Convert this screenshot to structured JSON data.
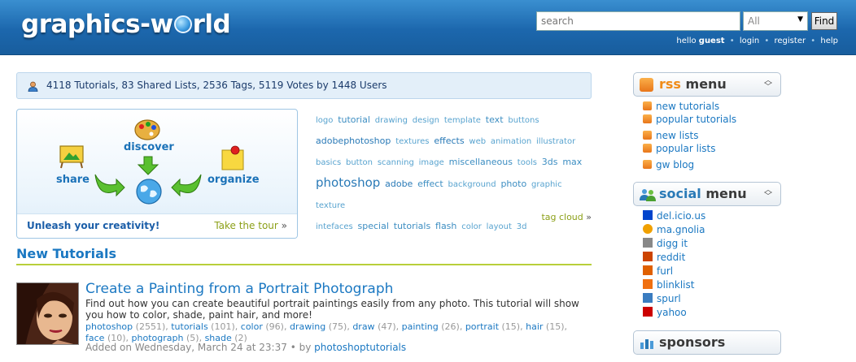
{
  "header": {
    "logo": "graphics-world",
    "search_placeholder": "search",
    "select_value": "All",
    "find_label": "Find",
    "greeting": "hello",
    "username": "guest",
    "links": [
      "login",
      "register",
      "help"
    ]
  },
  "stats": {
    "text": "4118 Tutorials, 83 Shared Lists, 2536 Tags, 5119 Votes by 1448 Users"
  },
  "tour": {
    "discover": "discover",
    "share": "share",
    "organize": "organize",
    "slogan": "Unleash your creativity!",
    "link": "Take the tour",
    "raquo": "»"
  },
  "tags": [
    {
      "t": "logo",
      "w": 0
    },
    {
      "t": "tutorial",
      "w": 1
    },
    {
      "t": "drawing",
      "w": 0
    },
    {
      "t": "design",
      "w": 0
    },
    {
      "t": "template",
      "w": 0
    },
    {
      "t": "text",
      "w": 1
    },
    {
      "t": "buttons",
      "w": 0
    },
    {
      "t": "adobephotoshop",
      "w": 2
    },
    {
      "t": "textures",
      "w": 0
    },
    {
      "t": "effects",
      "w": 2
    },
    {
      "t": "web",
      "w": 0
    },
    {
      "t": "animation",
      "w": 0
    },
    {
      "t": "illustrator",
      "w": 0
    },
    {
      "t": "basics",
      "w": 0
    },
    {
      "t": "button",
      "w": 0
    },
    {
      "t": "scanning",
      "w": 0
    },
    {
      "t": "image",
      "w": 0
    },
    {
      "t": "miscellaneous",
      "w": 1
    },
    {
      "t": "tools",
      "w": 0
    },
    {
      "t": "3ds",
      "w": 1
    },
    {
      "t": "max",
      "w": 1
    },
    {
      "t": "photoshop",
      "w": 3
    },
    {
      "t": "adobe",
      "w": 2
    },
    {
      "t": "effect",
      "w": 1
    },
    {
      "t": "background",
      "w": 0
    },
    {
      "t": "photo",
      "w": 1
    },
    {
      "t": "graphic",
      "w": 0
    },
    {
      "t": "texture",
      "w": 0
    },
    {
      "t": "intefaces",
      "w": 0
    },
    {
      "t": "special",
      "w": 1
    },
    {
      "t": "tutorials",
      "w": 1
    },
    {
      "t": "flash",
      "w": 1
    },
    {
      "t": "color",
      "w": 0
    },
    {
      "t": "layout",
      "w": 0
    },
    {
      "t": "3d",
      "w": 0
    }
  ],
  "tagcloud_link": "tag cloud",
  "section_title": "New Tutorials",
  "tutorial": {
    "title": "Create a Painting from a Portrait Photograph",
    "description": "Find out how you can create beautiful portrait paintings easily from any photo. This tutorial will show you how to color, shade, paint hair, and more!",
    "tags": [
      {
        "name": "photoshop",
        "count": "(2551)"
      },
      {
        "name": "tutorials",
        "count": "(101)"
      },
      {
        "name": "color",
        "count": "(96)"
      },
      {
        "name": "drawing",
        "count": "(75)"
      },
      {
        "name": "draw",
        "count": "(47)"
      },
      {
        "name": "painting",
        "count": "(26)"
      },
      {
        "name": "portrait",
        "count": "(15)"
      },
      {
        "name": "hair",
        "count": "(15)"
      },
      {
        "name": "face",
        "count": "(10)"
      },
      {
        "name": "photograph",
        "count": "(5)"
      },
      {
        "name": "shade",
        "count": "(2)"
      }
    ],
    "added": "Added on Wednesday, March 24 at 23:37",
    "by": "by",
    "author": "photoshoptutorials"
  },
  "rss_menu": {
    "title_hl": "rss",
    "title_rest": "menu",
    "items": [
      "new tutorials",
      "popular tutorials",
      "new lists",
      "popular lists",
      "gw blog"
    ]
  },
  "social_menu": {
    "title_hl": "social",
    "title_rest": "menu",
    "items": [
      {
        "label": "del.icio.us",
        "icon": "delicious-icon",
        "color": "#0044cc"
      },
      {
        "label": "ma.gnolia",
        "icon": "magnolia-icon",
        "color": "#f0a000"
      },
      {
        "label": "digg it",
        "icon": "digg-icon",
        "color": "#888888"
      },
      {
        "label": "reddit",
        "icon": "reddit-icon",
        "color": "#cc4400"
      },
      {
        "label": "furl",
        "icon": "furl-icon",
        "color": "#e06000"
      },
      {
        "label": "blinklist",
        "icon": "blinklist-icon",
        "color": "#f07010"
      },
      {
        "label": "spurl",
        "icon": "spurl-icon",
        "color": "#3a7cc0"
      },
      {
        "label": "yahoo",
        "icon": "yahoo-icon",
        "color": "#cc0000"
      }
    ]
  },
  "sponsors_menu": {
    "title": "sponsors"
  }
}
